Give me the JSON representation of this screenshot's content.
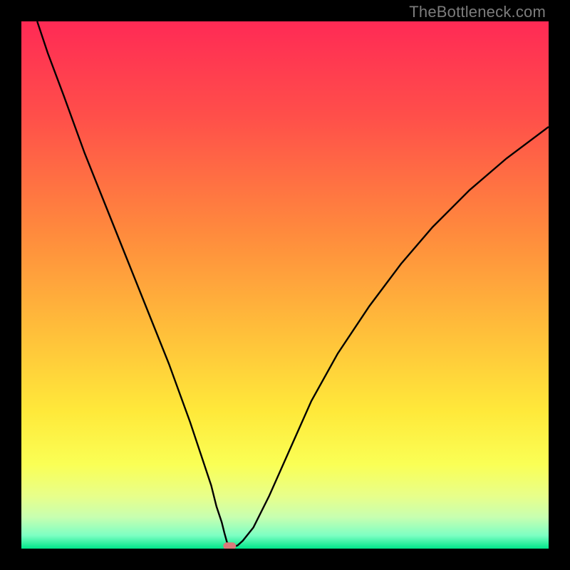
{
  "watermark": "TheBottleneck.com",
  "chart_data": {
    "type": "line",
    "title": "",
    "xlabel": "",
    "ylabel": "",
    "xlim": [
      0,
      100
    ],
    "ylim": [
      0,
      100
    ],
    "series": [
      {
        "name": "curve",
        "x": [
          3,
          5,
          8,
          12,
          16,
          20,
          24,
          28,
          32,
          34,
          36,
          37,
          38,
          38.5,
          39,
          39.5,
          40,
          41,
          42,
          44,
          47,
          51,
          55,
          60,
          66,
          72,
          78,
          85,
          92,
          100
        ],
        "y": [
          100,
          94,
          86,
          75,
          65,
          55,
          45,
          35,
          24,
          18,
          12,
          8,
          5,
          3,
          1.2,
          0.6,
          0.3,
          0.6,
          1.5,
          4,
          10,
          19,
          28,
          37,
          46,
          54,
          61,
          68,
          74,
          80
        ]
      }
    ],
    "min_marker": {
      "x": 39.5,
      "y": 0.5
    },
    "gradient_stops": [
      {
        "offset": 0.0,
        "color": "#ff2a55"
      },
      {
        "offset": 0.18,
        "color": "#ff4f4a"
      },
      {
        "offset": 0.4,
        "color": "#ff8a3d"
      },
      {
        "offset": 0.6,
        "color": "#ffc23a"
      },
      {
        "offset": 0.74,
        "color": "#ffe93a"
      },
      {
        "offset": 0.84,
        "color": "#faff55"
      },
      {
        "offset": 0.9,
        "color": "#e8ff8a"
      },
      {
        "offset": 0.94,
        "color": "#c8ffb0"
      },
      {
        "offset": 0.975,
        "color": "#7dffc3"
      },
      {
        "offset": 1.0,
        "color": "#00e68a"
      }
    ]
  }
}
